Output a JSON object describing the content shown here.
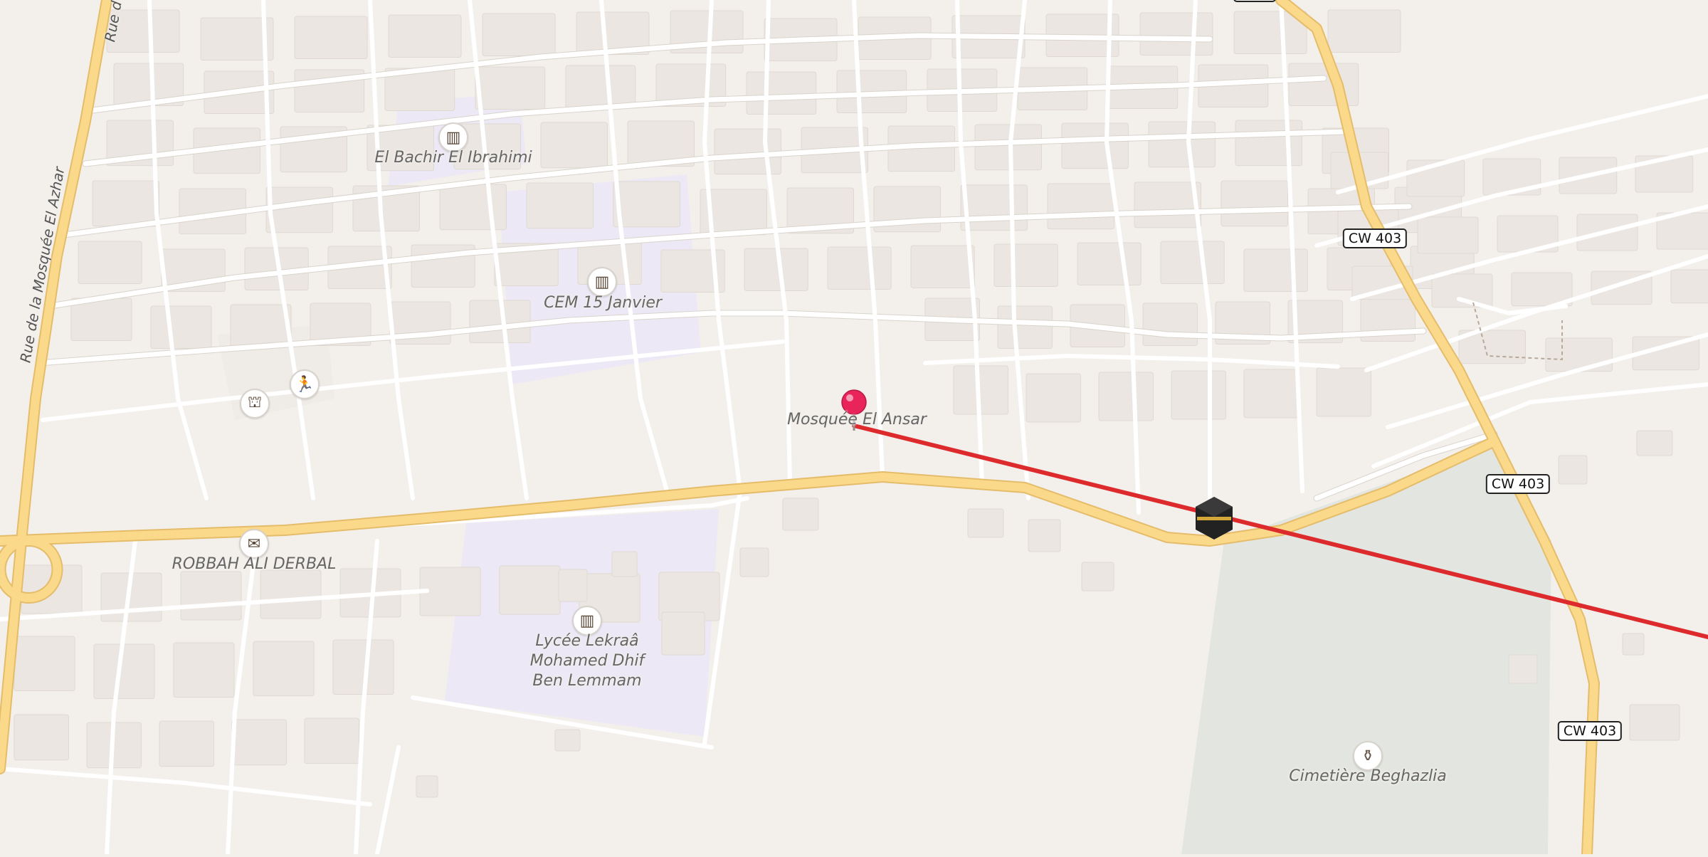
{
  "map": {
    "colors": {
      "background": "#f3f0ec",
      "building": "#ebe6e1",
      "minor_road": "#ffffff",
      "main_road": "#fbd98a",
      "school_area": "#ece8f6",
      "cemetery_area": "#e3e6e0",
      "route_line": "#dd2a2c",
      "pin": "#e8245a"
    },
    "labels": {
      "school_1": "El Bachir El Ibrahimi",
      "school_2": "CEM 15 Janvier",
      "mosque": "Mosquée El Ansar",
      "post_office": "ROBBAH ALI DERBAL",
      "lycee_line1": "Lycée Lekraâ",
      "lycee_line2": "Mohamed Dhif",
      "lycee_line3": "Ben Lemmam",
      "cemetery": "Cimetière Beghazlia",
      "street_west": "Rue de la Mosquée El Azhar",
      "street_west_top": "Rue d"
    },
    "route_shields": {
      "cw403_a": "CW 403",
      "cw403_b": "CW 403",
      "cw403_c": "CW 403"
    },
    "icons": {
      "school_1": "school-icon",
      "school_2": "school-icon",
      "school_3": "school-icon",
      "sport": "running-icon",
      "building": "townhall-icon",
      "post_office": "mail-icon",
      "cemetery": "cemetery-icon",
      "kaaba": "kaaba-marker-icon",
      "pin": "location-pin-icon"
    }
  }
}
